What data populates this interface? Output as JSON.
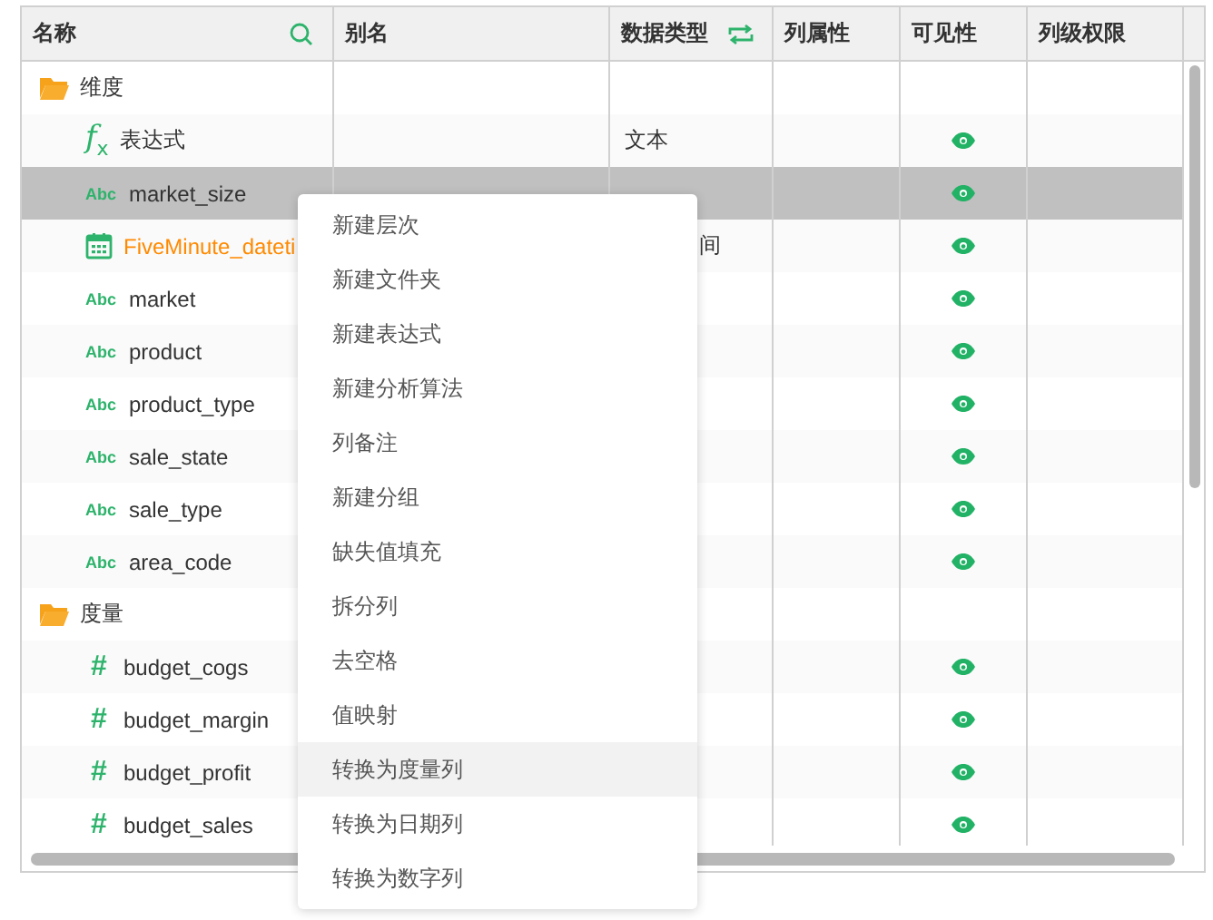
{
  "table": {
    "columns": [
      {
        "label": "名称",
        "kind": "search"
      },
      {
        "label": "别名"
      },
      {
        "label": "数据类型",
        "kind": "swap"
      },
      {
        "label": "列属性"
      },
      {
        "label": "可见性"
      },
      {
        "label": "列级权限"
      }
    ],
    "rows": [
      {
        "kind": "folder",
        "name": "维度",
        "visible": false,
        "selected": false
      },
      {
        "kind": "expression",
        "glyph": "f$_{x}$",
        "name": "表达式",
        "type": "文本",
        "visible": true,
        "selected": false
      },
      {
        "kind": "text",
        "glyph": "Abc",
        "name": "market_size",
        "visible": true,
        "selected": true
      },
      {
        "kind": "datetime",
        "name": "FiveMinute_dateti",
        "type": "间",
        "type_clipped": true,
        "visible": true,
        "selected": false
      },
      {
        "kind": "text",
        "glyph": "Abc",
        "name": "market",
        "visible": true,
        "selected": false
      },
      {
        "kind": "text",
        "glyph": "Abc",
        "name": "product",
        "visible": true,
        "selected": false
      },
      {
        "kind": "text",
        "glyph": "Abc",
        "name": "product_type",
        "visible": true,
        "selected": false
      },
      {
        "kind": "text",
        "glyph": "Abc",
        "name": "sale_state",
        "visible": true,
        "selected": false
      },
      {
        "kind": "text",
        "glyph": "Abc",
        "name": "sale_type",
        "visible": true,
        "selected": false
      },
      {
        "kind": "text",
        "glyph": "Abc",
        "name": "area_code",
        "visible": true,
        "selected": false
      },
      {
        "kind": "folder",
        "name": "度量",
        "visible": false,
        "selected": false
      },
      {
        "kind": "number",
        "glyph": "#",
        "name": "budget_cogs",
        "visible": true,
        "selected": false
      },
      {
        "kind": "number",
        "glyph": "#",
        "name": "budget_margin",
        "visible": true,
        "selected": false
      },
      {
        "kind": "number",
        "glyph": "#",
        "name": "budget_profit",
        "visible": true,
        "selected": false
      },
      {
        "kind": "number",
        "glyph": "#",
        "name": "budget_sales",
        "visible": true,
        "selected": false
      }
    ]
  },
  "context_menu": {
    "items": [
      {
        "label": "新建层次",
        "selected": false
      },
      {
        "label": "新建文件夹",
        "selected": false
      },
      {
        "label": "新建表达式",
        "selected": false
      },
      {
        "label": "新建分析算法",
        "selected": false
      },
      {
        "label": "列备注",
        "selected": false
      },
      {
        "label": "新建分组",
        "selected": false
      },
      {
        "label": "缺失值填充",
        "selected": false
      },
      {
        "label": "拆分列",
        "selected": false
      },
      {
        "label": "去空格",
        "selected": false
      },
      {
        "label": "值映射",
        "selected": false
      },
      {
        "label": "转换为度量列",
        "selected": true
      },
      {
        "label": "转换为日期列",
        "selected": false
      },
      {
        "label": "转换为数字列",
        "selected": false
      }
    ]
  }
}
